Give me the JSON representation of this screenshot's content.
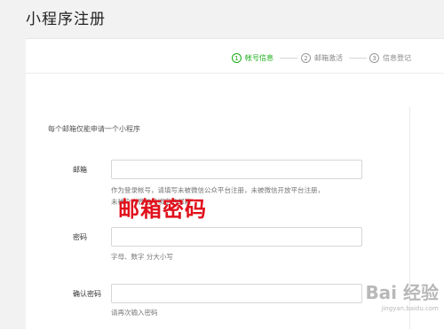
{
  "page_title": "小程序注册",
  "steps": [
    {
      "num": "1",
      "label": "帐号信息",
      "active": true
    },
    {
      "num": "2",
      "label": "邮箱激活",
      "active": false
    },
    {
      "num": "3",
      "label": "信息登记",
      "active": false
    }
  ],
  "form": {
    "intro": "每个邮箱仅能申请一个小程序",
    "email": {
      "label": "邮箱",
      "value": "",
      "hint_line1": "作为登录帐号，请填写未被微信公众平台注册，未被微信开放平台注册，",
      "hint_line2": "未被个人微信号绑定的邮箱"
    },
    "password": {
      "label": "密码",
      "value": "",
      "hint": "字母、数字                                    分大小写"
    },
    "confirm_password": {
      "label": "确认密码",
      "value": "",
      "hint": "请再次输入密码"
    }
  },
  "annotation_text": "邮箱密码",
  "watermark": {
    "logo": "Bai  经验",
    "url": "jingyan.baidu.com"
  },
  "colors": {
    "accent": "#1aad19",
    "annotation": "#e0101b"
  },
  "icons": [
    "paw-icon"
  ]
}
